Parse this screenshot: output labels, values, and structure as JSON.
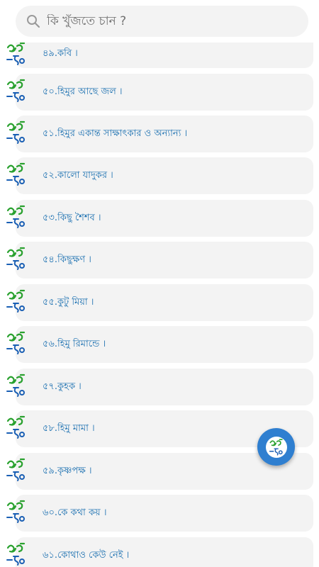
{
  "search": {
    "placeholder": "কি খুঁজতে চান ?"
  },
  "icons": {
    "search": "search-icon",
    "row_logo": "boi-tong-logo",
    "fab": "boi-tong-logo"
  },
  "colors": {
    "label": "#1a6fb0",
    "card": "#f3f3f3",
    "fab": "#2f7fd0",
    "logo_green": "#2aa12f",
    "logo_blue": "#1a5fb4"
  },
  "items": [
    {
      "label": "৪৯.কবি ।"
    },
    {
      "label": "৫০.হিমুর আছে জল ।"
    },
    {
      "label": "৫১.হিমুর একান্ত সাক্ষাৎকার ও অন্যান্য ।"
    },
    {
      "label": "৫২.কালো যাদুকর ।"
    },
    {
      "label": "৫৩.কিছু শৈশব ।"
    },
    {
      "label": "৫৪.কিছুক্ষণ ।"
    },
    {
      "label": "৫৫.কুটু মিয়া ।"
    },
    {
      "label": "৫৬.হিমু রিমান্ডে ।"
    },
    {
      "label": "৫৭.কুহক ।"
    },
    {
      "label": "৫৮.হিমু মামা ।"
    },
    {
      "label": "৫৯.কৃষ্ণপক্ষ ।"
    },
    {
      "label": "৬০.কে কথা কয় ।"
    },
    {
      "label": "৬১.কোথাও কেউ নেই ।"
    }
  ]
}
